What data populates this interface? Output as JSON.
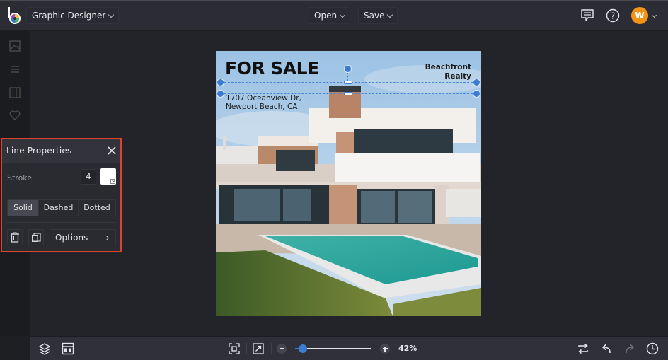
{
  "topbar": {
    "app_menu_label": "Graphic Designer",
    "open_label": "Open",
    "save_label": "Save",
    "avatar_initial": "W"
  },
  "leftrail": {
    "items": [
      {
        "icon": "image-icon"
      },
      {
        "icon": "text-icon"
      },
      {
        "icon": "background-pattern-icon"
      },
      {
        "icon": "heart-icon"
      }
    ]
  },
  "poster": {
    "title": "FOR SALE",
    "brand_line1": "Beachfront",
    "brand_line2": "Realty",
    "address_line1": "1707 Oceanview Dr,",
    "address_line2": "Newport Beach, CA"
  },
  "line_panel": {
    "title": "Line Properties",
    "stroke_label": "Stroke",
    "stroke_value": "4",
    "stroke_color": "#ffffff",
    "styles": [
      "Solid",
      "Dashed",
      "Dotted"
    ],
    "selected_style": "Solid",
    "options_label": "Options"
  },
  "bottombar": {
    "zoom_percent_label": "42%",
    "zoom_level": 0.1
  },
  "colors": {
    "accent": "#3d7bd0",
    "highlight_border": "#d9442b",
    "avatar_bg": "#f29316"
  }
}
